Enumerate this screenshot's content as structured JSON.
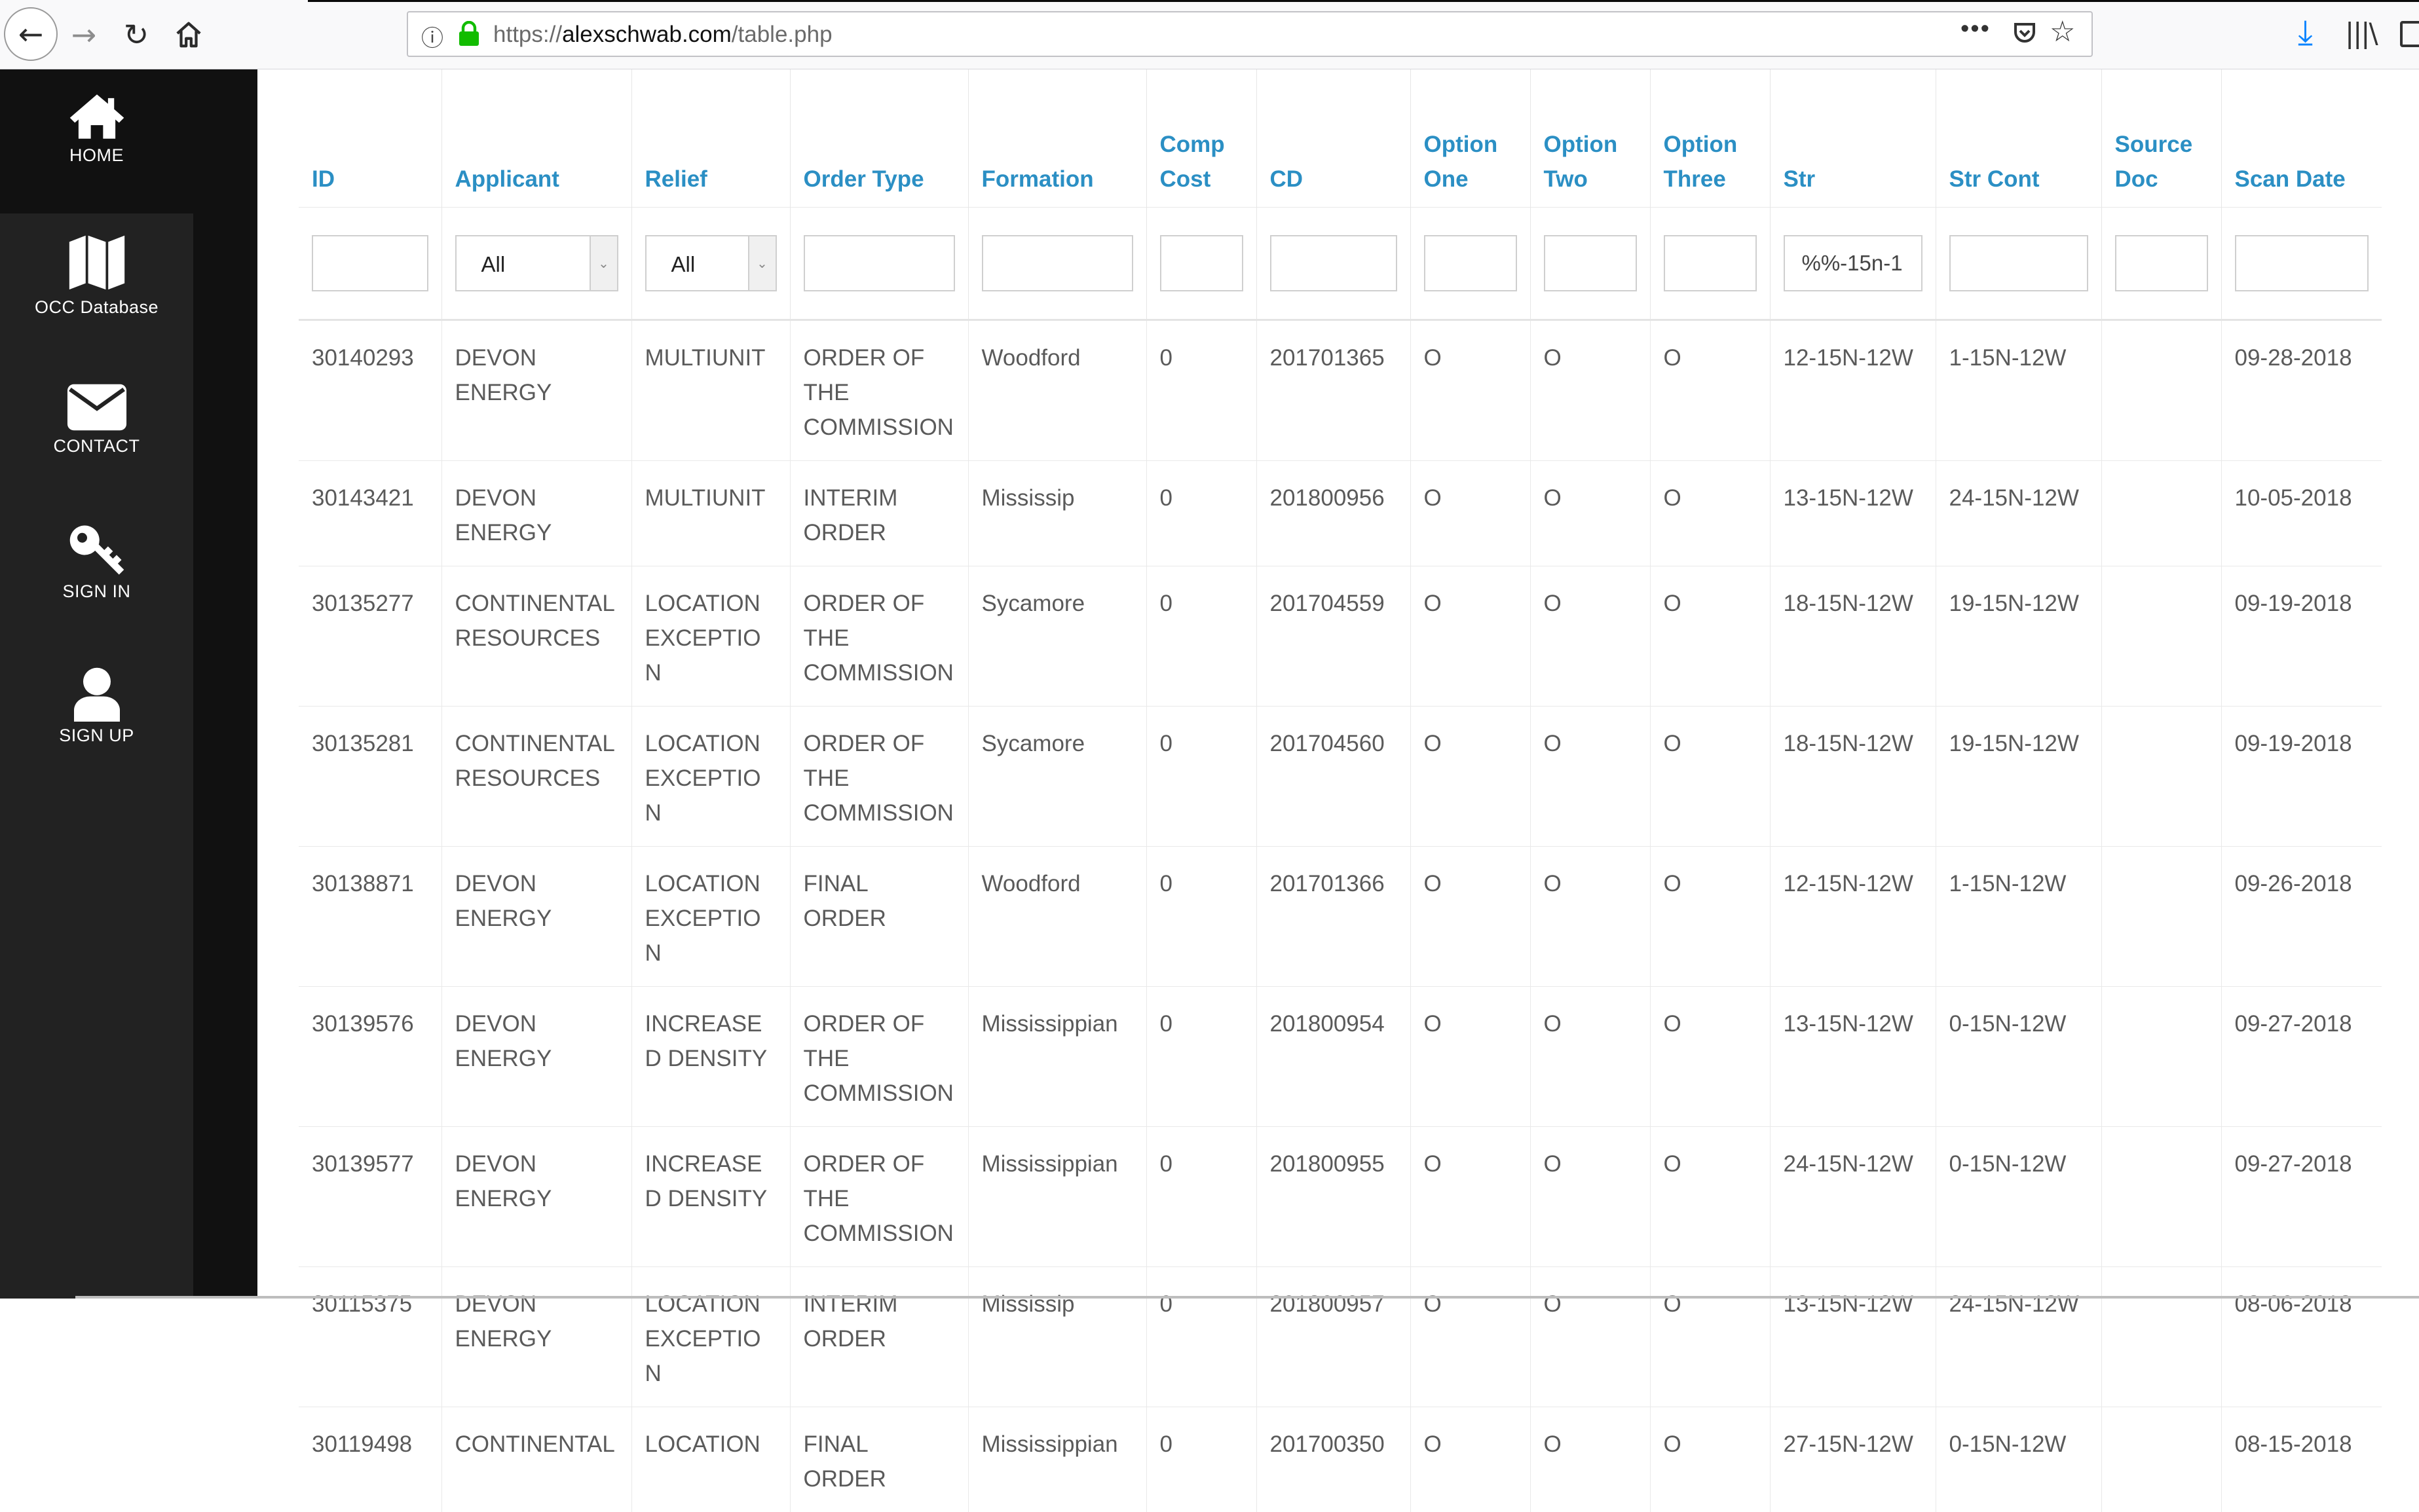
{
  "browser": {
    "url_prefix": "https://",
    "url_host": "alexschwab.com",
    "url_path": "/table.php",
    "more_label": "•••"
  },
  "nav": {
    "items": [
      {
        "label": "HOME",
        "icon": "home-icon"
      },
      {
        "label": "OCC Database",
        "icon": "map-icon"
      },
      {
        "label": "CONTACT",
        "icon": "envelope-icon"
      },
      {
        "label": "SIGN IN",
        "icon": "key-icon"
      },
      {
        "label": "SIGN UP",
        "icon": "user-icon"
      }
    ]
  },
  "table": {
    "headers": [
      "ID",
      "Applicant",
      "Relief",
      "Order Type",
      "Formation",
      "Comp Cost",
      "CD",
      "Option One",
      "Option Two",
      "Option Three",
      "Str",
      "Str Cont",
      "Source Doc",
      "Scan Date"
    ],
    "filters": {
      "applicant_select": "All",
      "relief_select": "All",
      "str_value": "%%-15n-1"
    },
    "rows": [
      [
        "30140293",
        "DEVON ENERGY",
        "MULTIUNIT",
        "ORDER OF THE COMMISSION",
        "Woodford",
        "0",
        "201701365",
        "O",
        "O",
        "O",
        "12-15N-12W",
        "1-15N-12W",
        "",
        "09-28-2018"
      ],
      [
        "30143421",
        "DEVON ENERGY",
        "MULTIUNIT",
        "INTERIM ORDER",
        "Mississip",
        "0",
        "201800956",
        "O",
        "O",
        "O",
        "13-15N-12W",
        "24-15N-12W",
        "",
        "10-05-2018"
      ],
      [
        "30135277",
        "CONTINENTAL RESOURCES",
        "LOCATION EXCEPTION",
        "ORDER OF THE COMMISSION",
        "Sycamore",
        "0",
        "201704559",
        "O",
        "O",
        "O",
        "18-15N-12W",
        "19-15N-12W",
        "",
        "09-19-2018"
      ],
      [
        "30135281",
        "CONTINENTAL RESOURCES",
        "LOCATION EXCEPTION",
        "ORDER OF THE COMMISSION",
        "Sycamore",
        "0",
        "201704560",
        "O",
        "O",
        "O",
        "18-15N-12W",
        "19-15N-12W",
        "",
        "09-19-2018"
      ],
      [
        "30138871",
        "DEVON ENERGY",
        "LOCATION EXCEPTION",
        "FINAL ORDER",
        "Woodford",
        "0",
        "201701366",
        "O",
        "O",
        "O",
        "12-15N-12W",
        "1-15N-12W",
        "",
        "09-26-2018"
      ],
      [
        "30139576",
        "DEVON ENERGY",
        "INCREASED DENSITY",
        "ORDER OF THE COMMISSION",
        "Mississippian",
        "0",
        "201800954",
        "O",
        "O",
        "O",
        "13-15N-12W",
        "0-15N-12W",
        "",
        "09-27-2018"
      ],
      [
        "30139577",
        "DEVON ENERGY",
        "INCREASED DENSITY",
        "ORDER OF THE COMMISSION",
        "Mississippian",
        "0",
        "201800955",
        "O",
        "O",
        "O",
        "24-15N-12W",
        "0-15N-12W",
        "",
        "09-27-2018"
      ],
      [
        "30115375",
        "DEVON ENERGY",
        "LOCATION EXCEPTION",
        "INTERIM ORDER",
        "Mississip",
        "0",
        "201800957",
        "O",
        "O",
        "O",
        "13-15N-12W",
        "24-15N-12W",
        "",
        "08-06-2018"
      ],
      [
        "30119498",
        "CONTINENTAL",
        "LOCATION",
        "FINAL ORDER",
        "Mississippian",
        "0",
        "201700350",
        "O",
        "O",
        "O",
        "27-15N-12W",
        "0-15N-12W",
        "",
        "08-15-2018"
      ]
    ]
  }
}
